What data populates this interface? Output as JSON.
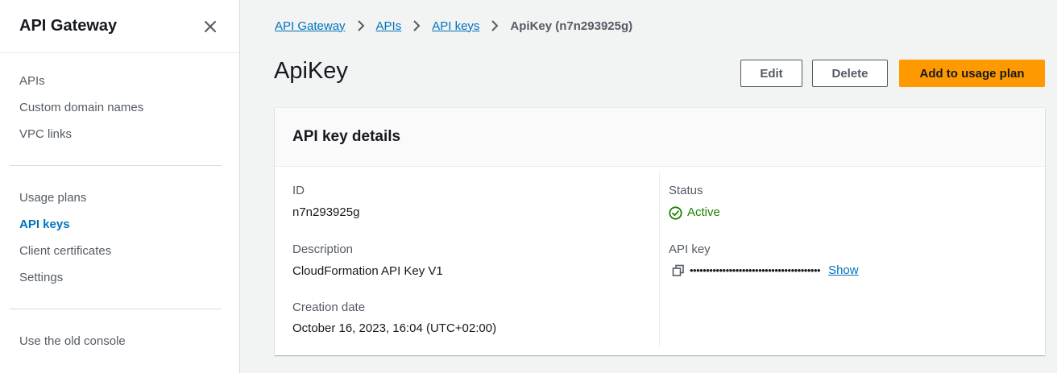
{
  "sidebar": {
    "title": "API Gateway",
    "group1": [
      {
        "label": "APIs"
      },
      {
        "label": "Custom domain names"
      },
      {
        "label": "VPC links"
      }
    ],
    "group2": [
      {
        "label": "Usage plans"
      },
      {
        "label": "API keys",
        "active": true
      },
      {
        "label": "Client certificates"
      },
      {
        "label": "Settings"
      }
    ],
    "group3": [
      {
        "label": "Use the old console"
      }
    ]
  },
  "breadcrumb": {
    "items": [
      "API Gateway",
      "APIs",
      "API keys"
    ],
    "current": "ApiKey (n7n293925g)"
  },
  "page": {
    "title": "ApiKey",
    "buttons": {
      "edit": "Edit",
      "delete": "Delete",
      "add_to_usage_plan": "Add to usage plan"
    }
  },
  "details": {
    "header": "API key details",
    "id_label": "ID",
    "id_value": "n7n293925g",
    "description_label": "Description",
    "description_value": "CloudFormation API Key V1",
    "creation_label": "Creation date",
    "creation_value": "October 16, 2023, 16:04 (UTC+02:00)",
    "status_label": "Status",
    "status_value": "Active",
    "apikey_label": "API key",
    "apikey_masked": "••••••••••••••••••••••••••••••••••••••••",
    "show_label": "Show"
  },
  "icons": {
    "close": "close-icon",
    "chevron": "chevron-right-icon",
    "status": "check-circle-icon",
    "copy": "copy-icon"
  },
  "colors": {
    "link": "#0073bb",
    "primary": "#ff9900",
    "success": "#1d8102"
  }
}
